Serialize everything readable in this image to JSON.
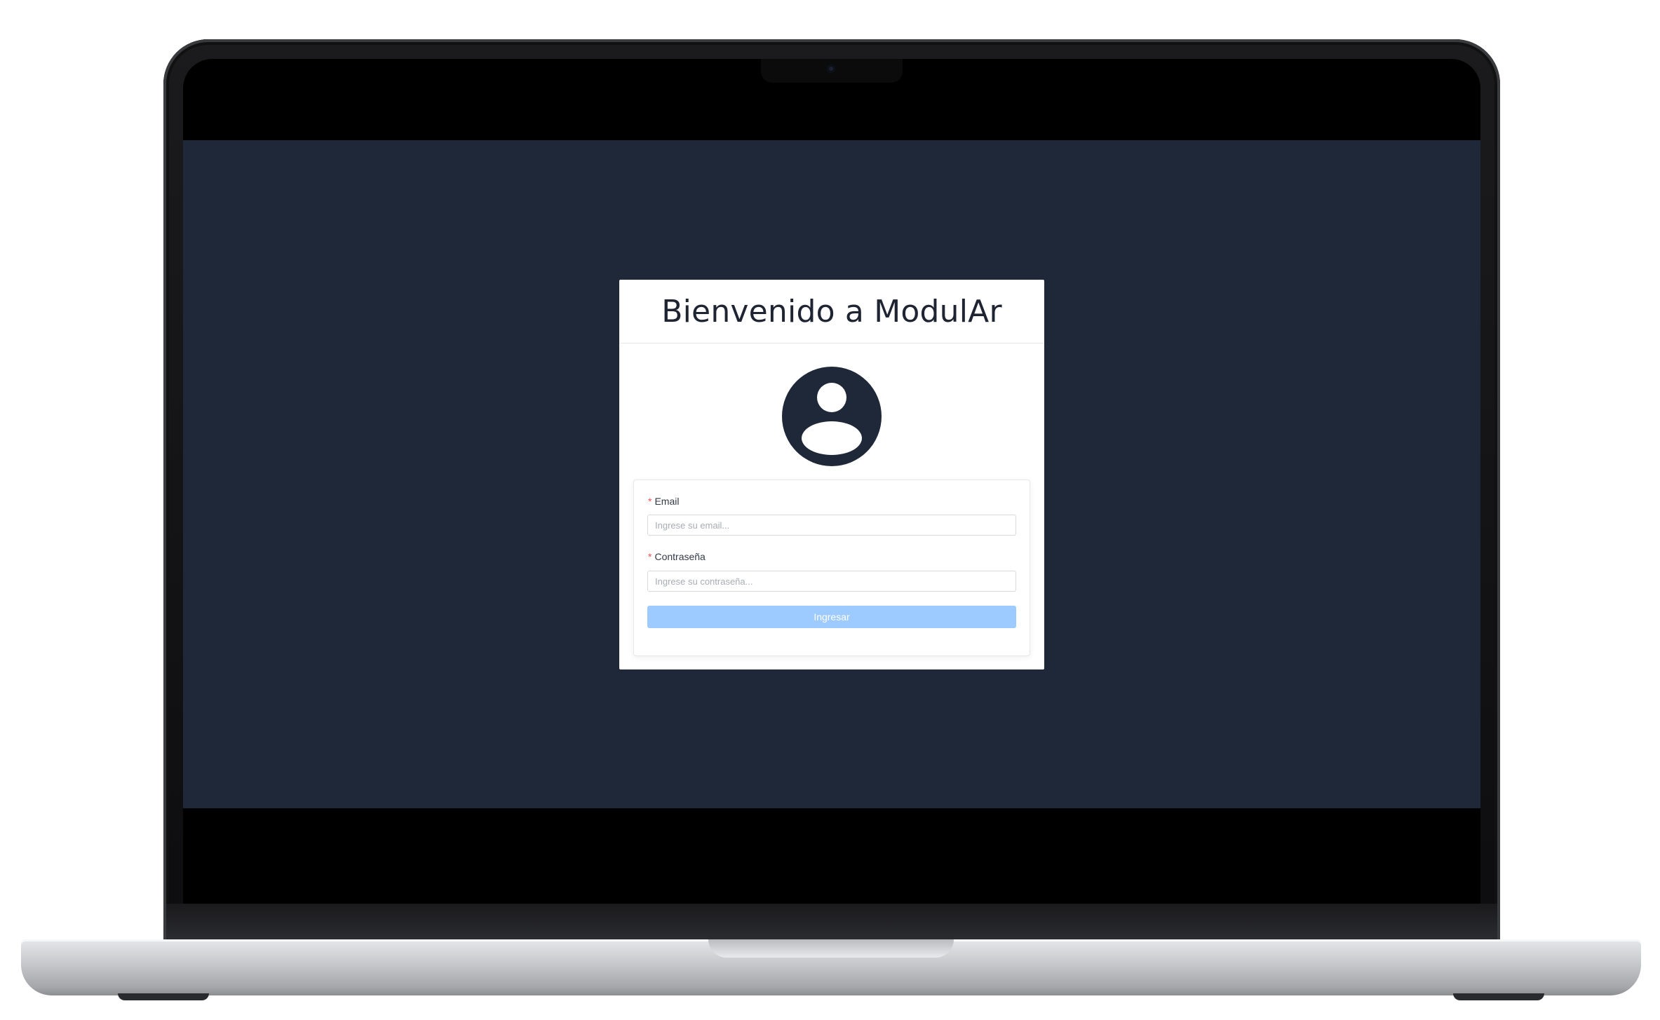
{
  "app": {
    "title": "Bienvenido a ModulAr"
  },
  "icons": {
    "avatar": "user-avatar-icon"
  },
  "colors": {
    "screen_background": "#1f2839",
    "avatar": "#1f2839",
    "button_background": "#9ecbff",
    "required_marker": "#ff4d4f"
  },
  "form": {
    "email": {
      "required_marker": "*",
      "label": "Email",
      "placeholder": "Ingrese su email...",
      "value": ""
    },
    "password": {
      "required_marker": "*",
      "label": "Contraseña",
      "placeholder": "Ingrese su contraseña...",
      "value": ""
    },
    "submit_label": "Ingresar"
  }
}
